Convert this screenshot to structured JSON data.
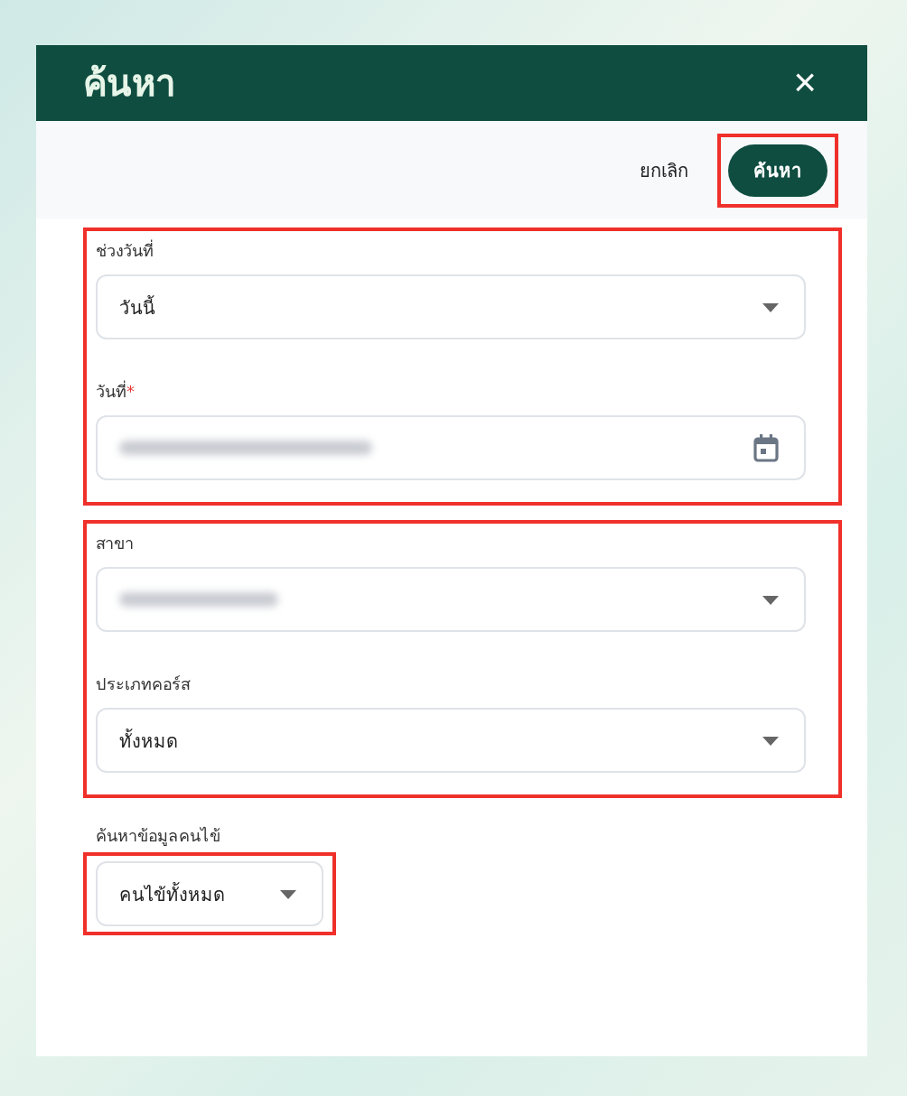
{
  "dialog": {
    "title": "ค้นหา",
    "close": "×"
  },
  "actions": {
    "cancel": "ยกเลิก",
    "submit": {
      "label": "ค้นหา",
      "highlighted": true
    }
  },
  "sections": [
    {
      "highlighted": true,
      "fields": [
        {
          "kind": "select",
          "label": "ช่วงวันที่",
          "value": "วันนี้",
          "redacted": false,
          "highlighted": false
        },
        {
          "kind": "date",
          "label": "วันที่",
          "required_mark": "*",
          "redacted": true,
          "highlighted": false
        }
      ]
    },
    {
      "highlighted": true,
      "fields": [
        {
          "kind": "select",
          "label": "สาขา",
          "redacted": true,
          "highlighted": false
        },
        {
          "kind": "select",
          "label": "ประเภทคอร์ส",
          "value": "ทั้งหมด",
          "redacted": false,
          "highlighted": false
        }
      ]
    },
    {
      "highlighted": false,
      "fields": [
        {
          "kind": "small_select",
          "label": "ค้นหาข้อมูลคนไข้",
          "value": "คนไข้ทั้งหมด",
          "redacted": false,
          "highlighted": true
        }
      ]
    }
  ]
}
